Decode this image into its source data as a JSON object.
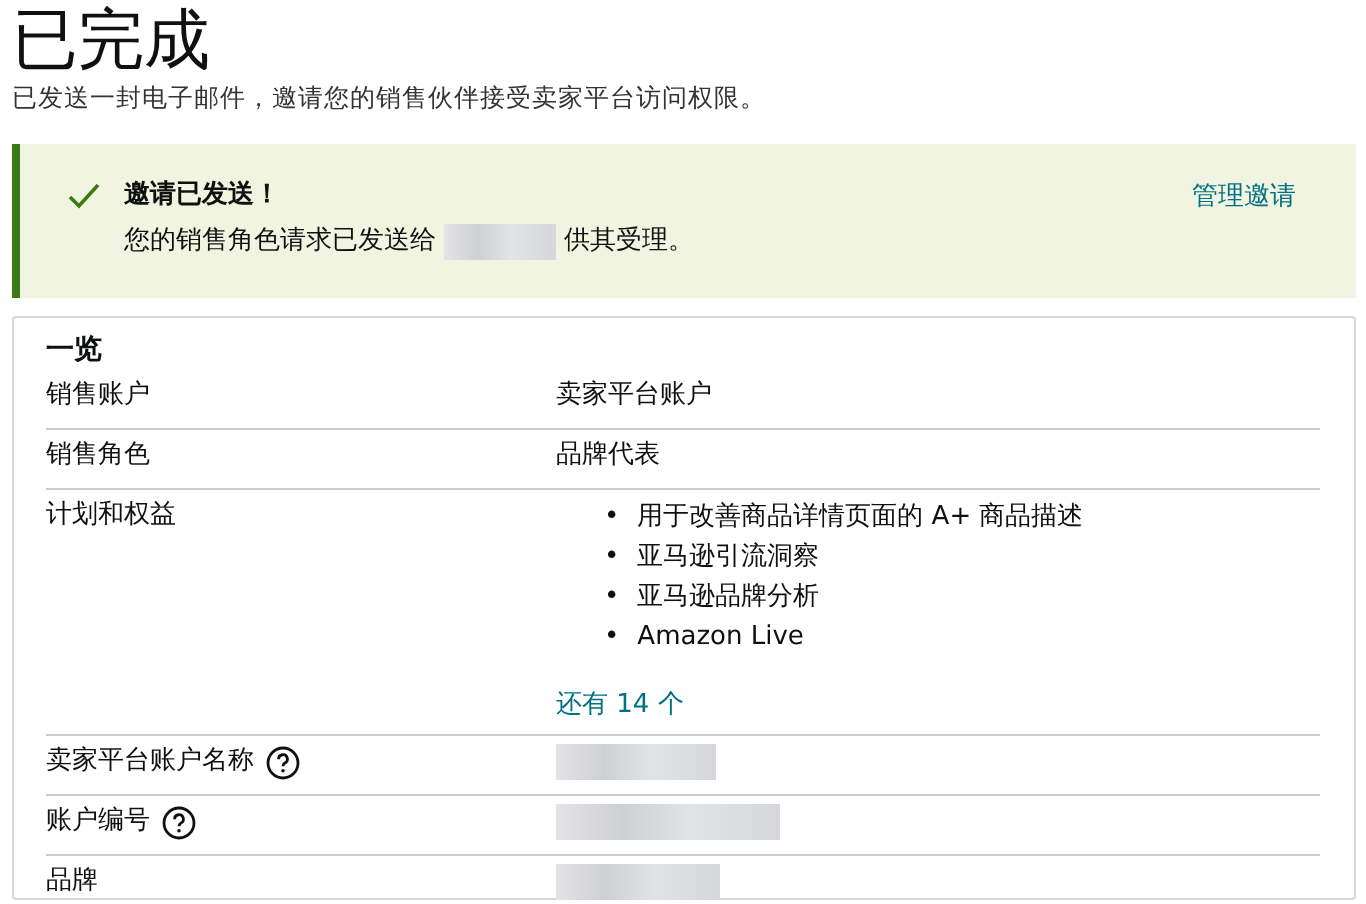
{
  "page": {
    "title": "已完成",
    "subtitle": "已发送一封电子邮件，邀请您的销售伙伴接受卖家平台访问权限。"
  },
  "alert": {
    "kind": "success",
    "title": "邀请已发送！",
    "message_before": "您的销售角色请求已发送给",
    "message_redacted": true,
    "message_after": "供其受理。",
    "link": "管理邀请"
  },
  "overview": {
    "title": "一览",
    "rows": [
      {
        "label": "销售账户",
        "kind": "text",
        "value": "卖家平台账户"
      },
      {
        "label": "销售角色",
        "kind": "text",
        "value": "品牌代表"
      },
      {
        "label": "计划和权益",
        "kind": "list",
        "bullet": "•",
        "items": [
          "用于改善商品详情页面的 A+ 商品描述",
          "亚马逊引流洞察",
          "亚马逊品牌分析",
          "Amazon Live"
        ],
        "more_link": "还有 14 个"
      },
      {
        "label": "卖家平台账户名称",
        "kind": "redacted",
        "help": true
      },
      {
        "label": "账户编号",
        "kind": "redacted",
        "help": true
      },
      {
        "label": "品牌",
        "kind": "redacted",
        "help": false
      }
    ]
  }
}
